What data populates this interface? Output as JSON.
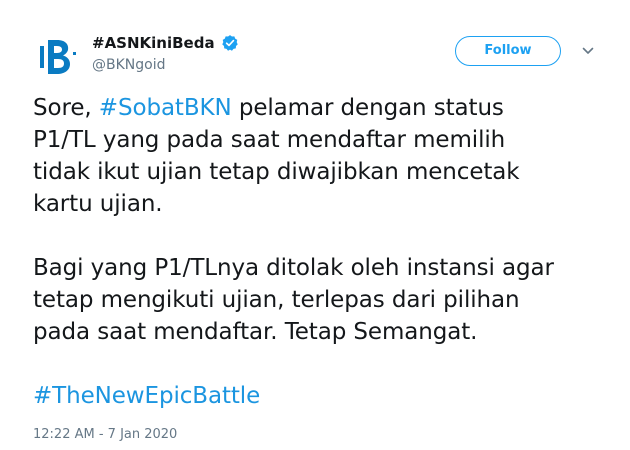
{
  "account": {
    "display_name": "#ASNKiniBeda",
    "handle": "@BKNgoid",
    "verified": true,
    "avatar_letter": "B"
  },
  "follow_label": "Follow",
  "tweet": {
    "p1_prefix": "Sore, ",
    "p1_hashtag": "#SobatBKN",
    "p1_line1_rest": " pelamar dengan status",
    "p1_line2": "P1/TL yang pada saat mendaftar memilih",
    "p1_line3": "tidak ikut ujian tetap diwajibkan mencetak",
    "p1_line4": "kartu ujian.",
    "p2_line1": "Bagi yang P1/TLnya ditolak oleh instansi agar",
    "p2_line2": "tetap mengikuti ujian, terlepas dari pilihan",
    "p2_line3": "pada saat mendaftar. Tetap Semangat.",
    "hashtag_final": "#TheNewEpicBattle"
  },
  "timestamp": "12:22 AM - 7 Jan 2020",
  "colors": {
    "accent": "#1da1f2",
    "link": "#1b95e0",
    "text": "#14171a",
    "muted": "#657786",
    "brand_blue": "#0a7bc2"
  }
}
